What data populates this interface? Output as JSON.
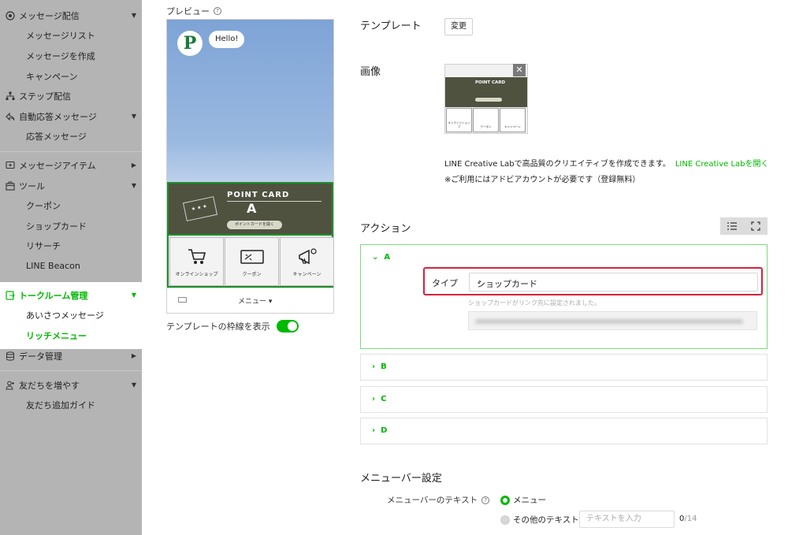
{
  "sidebar": {
    "items": [
      {
        "label": "メッセージ配信",
        "icon": "broadcast-icon",
        "arrow": "▼"
      },
      {
        "label": "メッセージリスト"
      },
      {
        "label": "メッセージを作成"
      },
      {
        "label": "キャンペーン"
      },
      {
        "label": "ステップ配信",
        "icon": "step-icon"
      },
      {
        "label": "自動応答メッセージ",
        "icon": "reply-icon",
        "arrow": "▼"
      },
      {
        "label": "応答メッセージ"
      },
      {
        "label": "メッセージアイテム",
        "icon": "item-icon",
        "arrow": "▶"
      },
      {
        "label": "ツール",
        "icon": "tool-icon",
        "arrow": "▼"
      },
      {
        "label": "クーポン"
      },
      {
        "label": "ショップカード"
      },
      {
        "label": "リサーチ"
      },
      {
        "label": "LINE Beacon"
      },
      {
        "label": "トークルーム管理",
        "icon": "chatroom-icon",
        "arrow": "▼"
      },
      {
        "label": "あいさつメッセージ"
      },
      {
        "label": "リッチメニュー"
      },
      {
        "label": "データ管理",
        "icon": "data-icon",
        "arrow": "▶"
      },
      {
        "label": "友だちを増やす",
        "icon": "friend-add-icon",
        "arrow": "▼"
      },
      {
        "label": "友だち追加ガイド"
      }
    ]
  },
  "preview": {
    "label": "プレビュー",
    "help": "?",
    "bubble": "Hello!",
    "avatar_letter": "P",
    "rich_menu": {
      "title": "POINT CARD",
      "area_letter": "A",
      "card_dots": "★★★",
      "button": "ポイントカードを開く",
      "cells": [
        "オンラインショップ",
        "クーポン",
        "キャンペーン"
      ]
    },
    "menubar_label": "メニュー ▾",
    "toggle_label": "テンプレートの枠線を表示",
    "toggle_on": true
  },
  "settings": {
    "template_label": "テンプレート",
    "change_button": "変更",
    "image_label": "画像",
    "thumb": {
      "title": "POINT CARD",
      "cells": [
        "オンラインショップ",
        "クーポン",
        "キャンペーン"
      ]
    },
    "close": "✕",
    "creative_lab_text": "LINE Creative Labで高品質のクリエイティブを作成できます。",
    "creative_lab_link": "LINE Creative Labを開く",
    "note": "※ご利用にはアドビアカウントが必要です（登録無料）",
    "action_label": "アクション",
    "accordions": [
      {
        "label": "A",
        "expanded": true
      },
      {
        "label": "B"
      },
      {
        "label": "C"
      },
      {
        "label": "D"
      }
    ],
    "action_a": {
      "type_label": "タイプ",
      "type_value": "ショップカード",
      "help": "ショップカードがリンク先に設定されました。"
    },
    "menubar_settings_label": "メニューバー設定",
    "menubar_text_label": "メニューバーのテキスト",
    "radio_menu": "メニュー",
    "radio_other": "その他のテキスト",
    "text_placeholder": "テキストを入力",
    "counter_current": "0",
    "counter_max": "/14"
  },
  "colors": {
    "accent": "#00b900",
    "highlight": "#d4233a",
    "sidebar_bg": "#b4b4b4",
    "rich_bg": "#4e523f"
  }
}
